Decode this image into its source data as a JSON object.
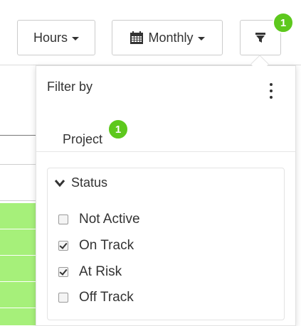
{
  "toolbar": {
    "hours_label": "Hours",
    "period_label": "Monthly",
    "filter_count": "1"
  },
  "filter_panel": {
    "title": "Filter by",
    "tabs": [
      {
        "label": "Project",
        "count": "1"
      }
    ],
    "status_group": {
      "label": "Status",
      "options": [
        {
          "label": "Not Active",
          "checked": false
        },
        {
          "label": "On Track",
          "checked": true
        },
        {
          "label": "At Risk",
          "checked": true
        },
        {
          "label": "Off Track",
          "checked": false
        }
      ]
    }
  },
  "colors": {
    "badge": "#5dc81d",
    "row_highlight": "#a6f07a"
  }
}
